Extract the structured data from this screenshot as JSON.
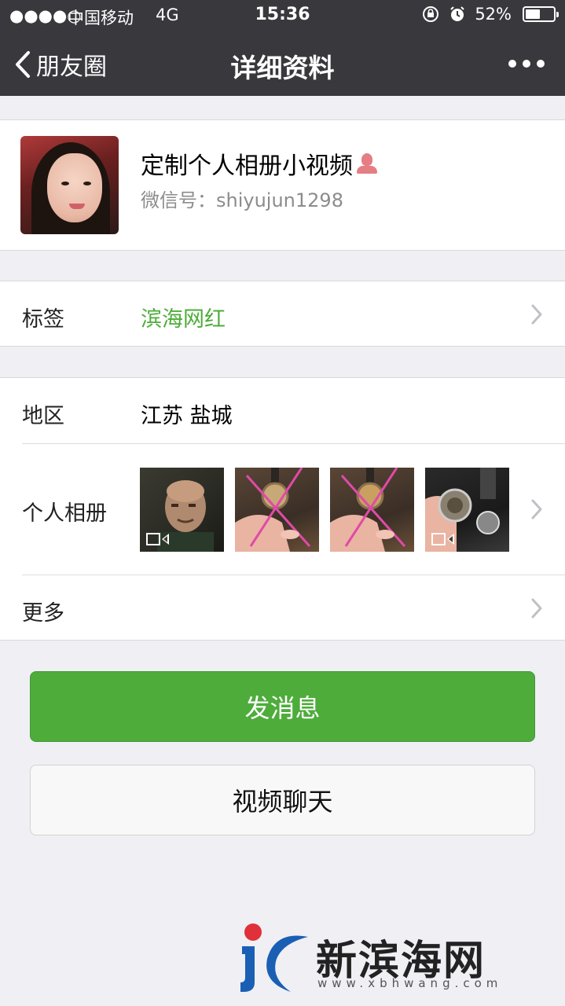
{
  "status_bar": {
    "signal": "●●●●○",
    "carrier": "中国移动",
    "network": "4G",
    "time": "15:36",
    "battery": "52%",
    "battery_level": 0.52
  },
  "nav": {
    "back_label": "朋友圈",
    "title": "详细资料"
  },
  "profile": {
    "name": "定制个人相册小视频",
    "wechat_id": "微信号：shiyujun1298"
  },
  "tag_row": {
    "label": "标签",
    "value": "滨海网红",
    "value_color": "#4eac3b"
  },
  "region_row": {
    "label": "地区",
    "value": "江苏 盐城"
  },
  "album_row": {
    "label": "个人相册",
    "thumbnails": [
      {
        "desc": "man-portrait",
        "video": true
      },
      {
        "desc": "watch-on-hand",
        "video": false
      },
      {
        "desc": "watch-on-hand",
        "video": false
      },
      {
        "desc": "watch-in-hand",
        "video": true
      }
    ]
  },
  "more_row": {
    "label": "更多"
  },
  "buttons": {
    "send_message": "发消息",
    "video_chat": "视频聊天"
  },
  "watermark": {
    "brand": "新滨海网",
    "url": "www.xbhwang.com"
  },
  "colors": {
    "nav_bg": "#38383d",
    "page_bg": "#efeff4",
    "accent_green": "#4eac3b"
  }
}
